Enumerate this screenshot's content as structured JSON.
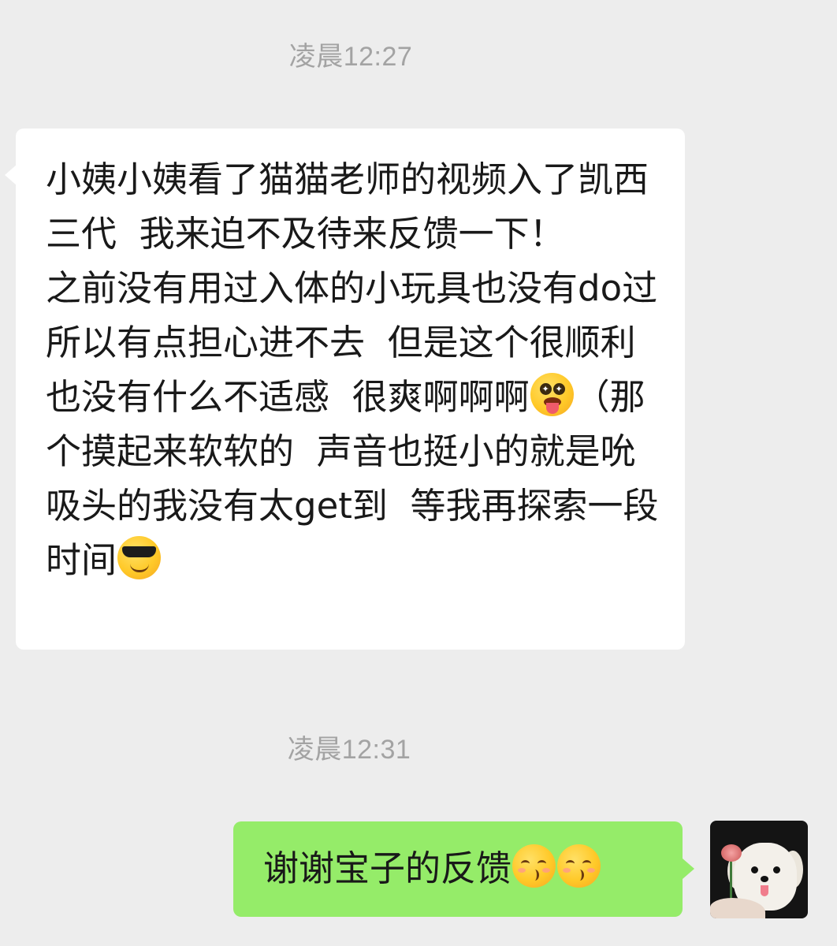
{
  "conversation": {
    "messages": [
      {
        "timestamp": "凌晨12:27",
        "direction": "incoming",
        "segments": [
          {
            "type": "text",
            "value": "小姨小姨看了猫猫老师的视频入了凯西三代  我来迫不及待来反馈一下！      之前没有用过入体的小玩具也没有do过  所以有点担心进不去  但是这个很顺利  也没有什么不适感  很爽啊啊啊"
          },
          {
            "type": "emoji",
            "name": "star-struck-tongue-emoji"
          },
          {
            "type": "text",
            "value": "（那个摸起来软软的  声音也挺小的就是吮吸头的我没有太get到  等我再探索一段时间"
          },
          {
            "type": "emoji",
            "name": "sunglasses-emoji"
          }
        ]
      },
      {
        "timestamp": "凌晨12:31",
        "direction": "outgoing",
        "segments": [
          {
            "type": "text",
            "value": "谢谢宝子的反馈"
          },
          {
            "type": "emoji",
            "name": "kissing-emoji"
          },
          {
            "type": "emoji",
            "name": "kissing-emoji"
          }
        ]
      }
    ]
  },
  "ui": {
    "incoming_bubble_color": "#ffffff",
    "outgoing_bubble_color": "#95ec69",
    "background_color": "#ededed",
    "timestamp_color": "#a3a3a3",
    "self_avatar": "white-maltese-puppy-with-rose"
  }
}
